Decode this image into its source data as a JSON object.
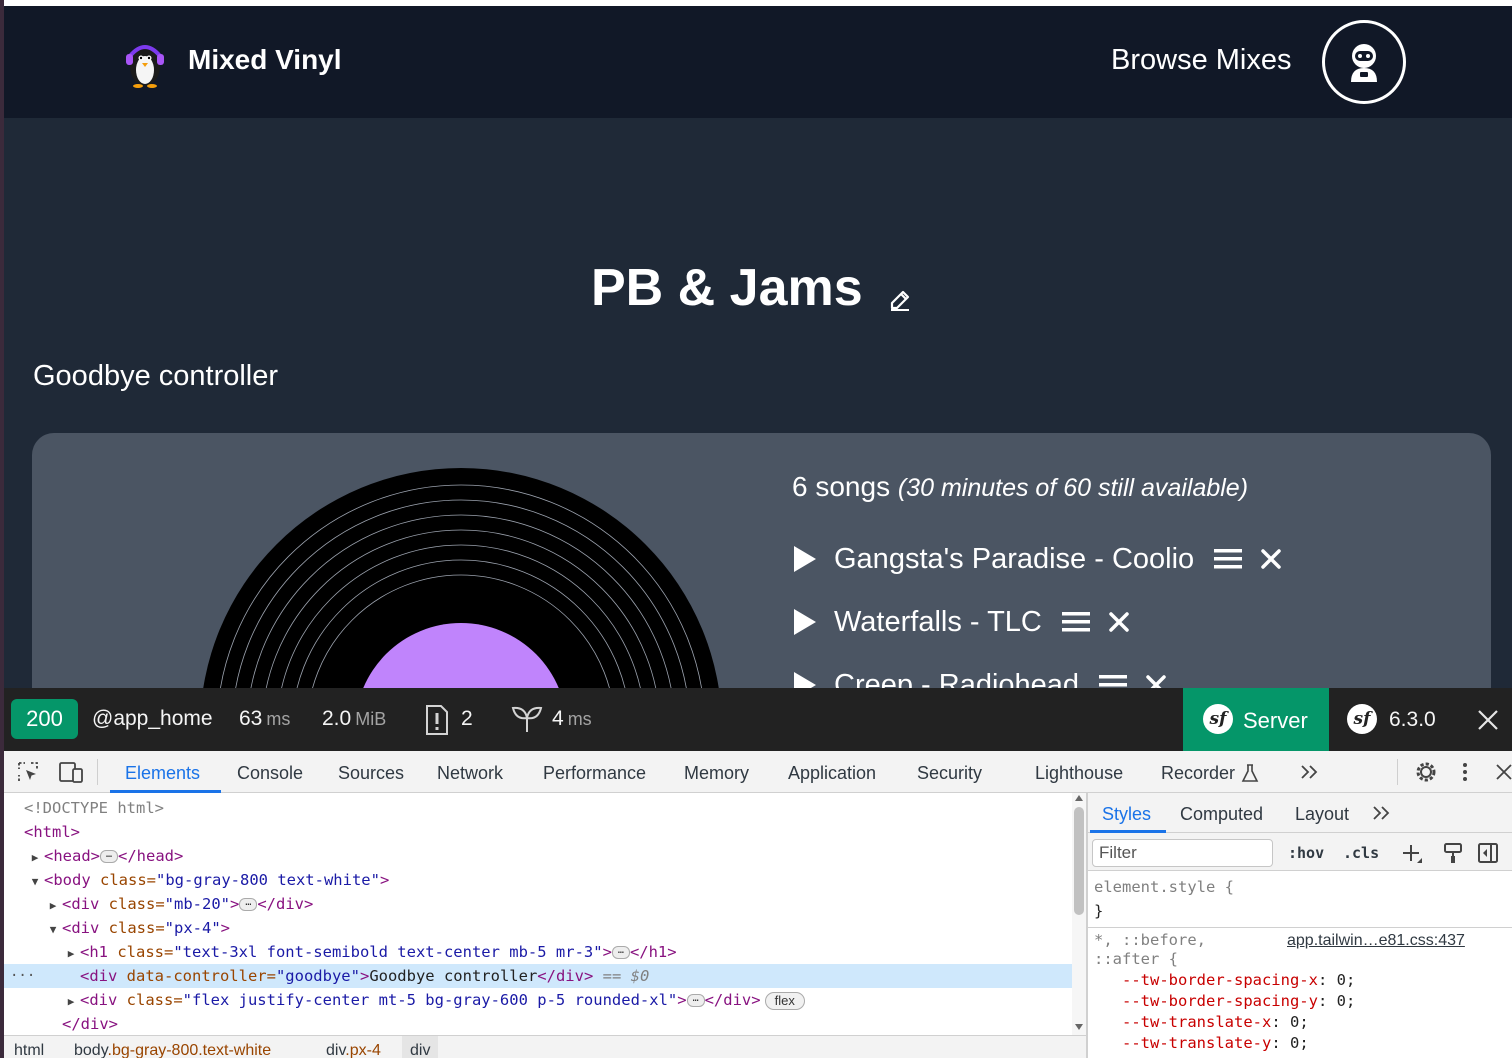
{
  "site": {
    "brand": "Mixed Vinyl",
    "nav_link": "Browse Mixes",
    "mix_title": "PB & Jams",
    "goodbye_text": "Goodbye controller",
    "songs_count": "6 songs",
    "songs_available": "(30 minutes of 60 still available)",
    "tracks": [
      {
        "label": "Gangsta's Paradise - Coolio"
      },
      {
        "label": "Waterfalls - TLC"
      },
      {
        "label": "Creep - Radiohead"
      }
    ],
    "colors": {
      "nav_bg": "#111827",
      "page_bg": "#1f2937",
      "panel_bg": "#4b5563",
      "vinyl_center": "#c084fc"
    }
  },
  "toolbar": {
    "status_code": "200",
    "route": "@app_home",
    "time_value": "63",
    "time_unit": "ms",
    "memory_value": "2.0",
    "memory_unit": "MiB",
    "logs_count": "2",
    "twig_value": "4",
    "twig_unit": "ms",
    "server_label": "Server",
    "version": "6.3.0",
    "accent": "#059669"
  },
  "devtools": {
    "tabs": [
      "Elements",
      "Console",
      "Sources",
      "Network",
      "Performance",
      "Memory",
      "Application",
      "Security",
      "Lighthouse",
      "Recorder"
    ],
    "active_tab": "Elements",
    "dom": {
      "doctype": "<!DOCTYPE html>",
      "html_open": "<html>",
      "head_open": "<head>",
      "head_close": "</head>",
      "body_tag_open": "<body",
      "body_attr": " class=",
      "body_val": "\"bg-gray-800 text-white\"",
      "body_end": ">",
      "div1_open": "<div",
      "div1_attr": " class=",
      "div1_val": "\"mb-20\"",
      "div1_end": ">",
      "div_close": "</div>",
      "div2_val": "\"px-4\"",
      "h1_open": "<h1",
      "h1_val": "\"text-3xl font-semibold text-center mb-5 mr-3\"",
      "h1_close": "</h1>",
      "sel_attr": " data-controller=",
      "sel_val": "\"goodbye\"",
      "sel_text": "Goodbye controller",
      "sel_marker": "== $0",
      "flex_val": "\"flex justify-center mt-5 bg-gray-600 p-5 rounded-xl\"",
      "flex_badge": "flex",
      "gutter": "···"
    },
    "breadcrumb": {
      "html": "html",
      "body_tag": "body",
      "body_cls": ".bg-gray-800.text-white",
      "div_tag": "div",
      "div_cls": ".px-4",
      "active": "div"
    },
    "styles": {
      "tabs": [
        "Styles",
        "Computed",
        "Layout"
      ],
      "filter_placeholder": "Filter",
      "hov": ":hov",
      "cls": ".cls",
      "element_style": "element.style {",
      "close_brace": "}",
      "rule_selector_1": "*, ::before,",
      "rule_selector_2": "::after {",
      "source": "app.tailwin…e81.css:437",
      "props": [
        {
          "name": "--tw-border-spacing-x",
          "value": "0;"
        },
        {
          "name": "--tw-border-spacing-y",
          "value": "0;"
        },
        {
          "name": "--tw-translate-x",
          "value": "0;"
        },
        {
          "name": "--tw-translate-y",
          "value": "0;"
        }
      ]
    }
  }
}
